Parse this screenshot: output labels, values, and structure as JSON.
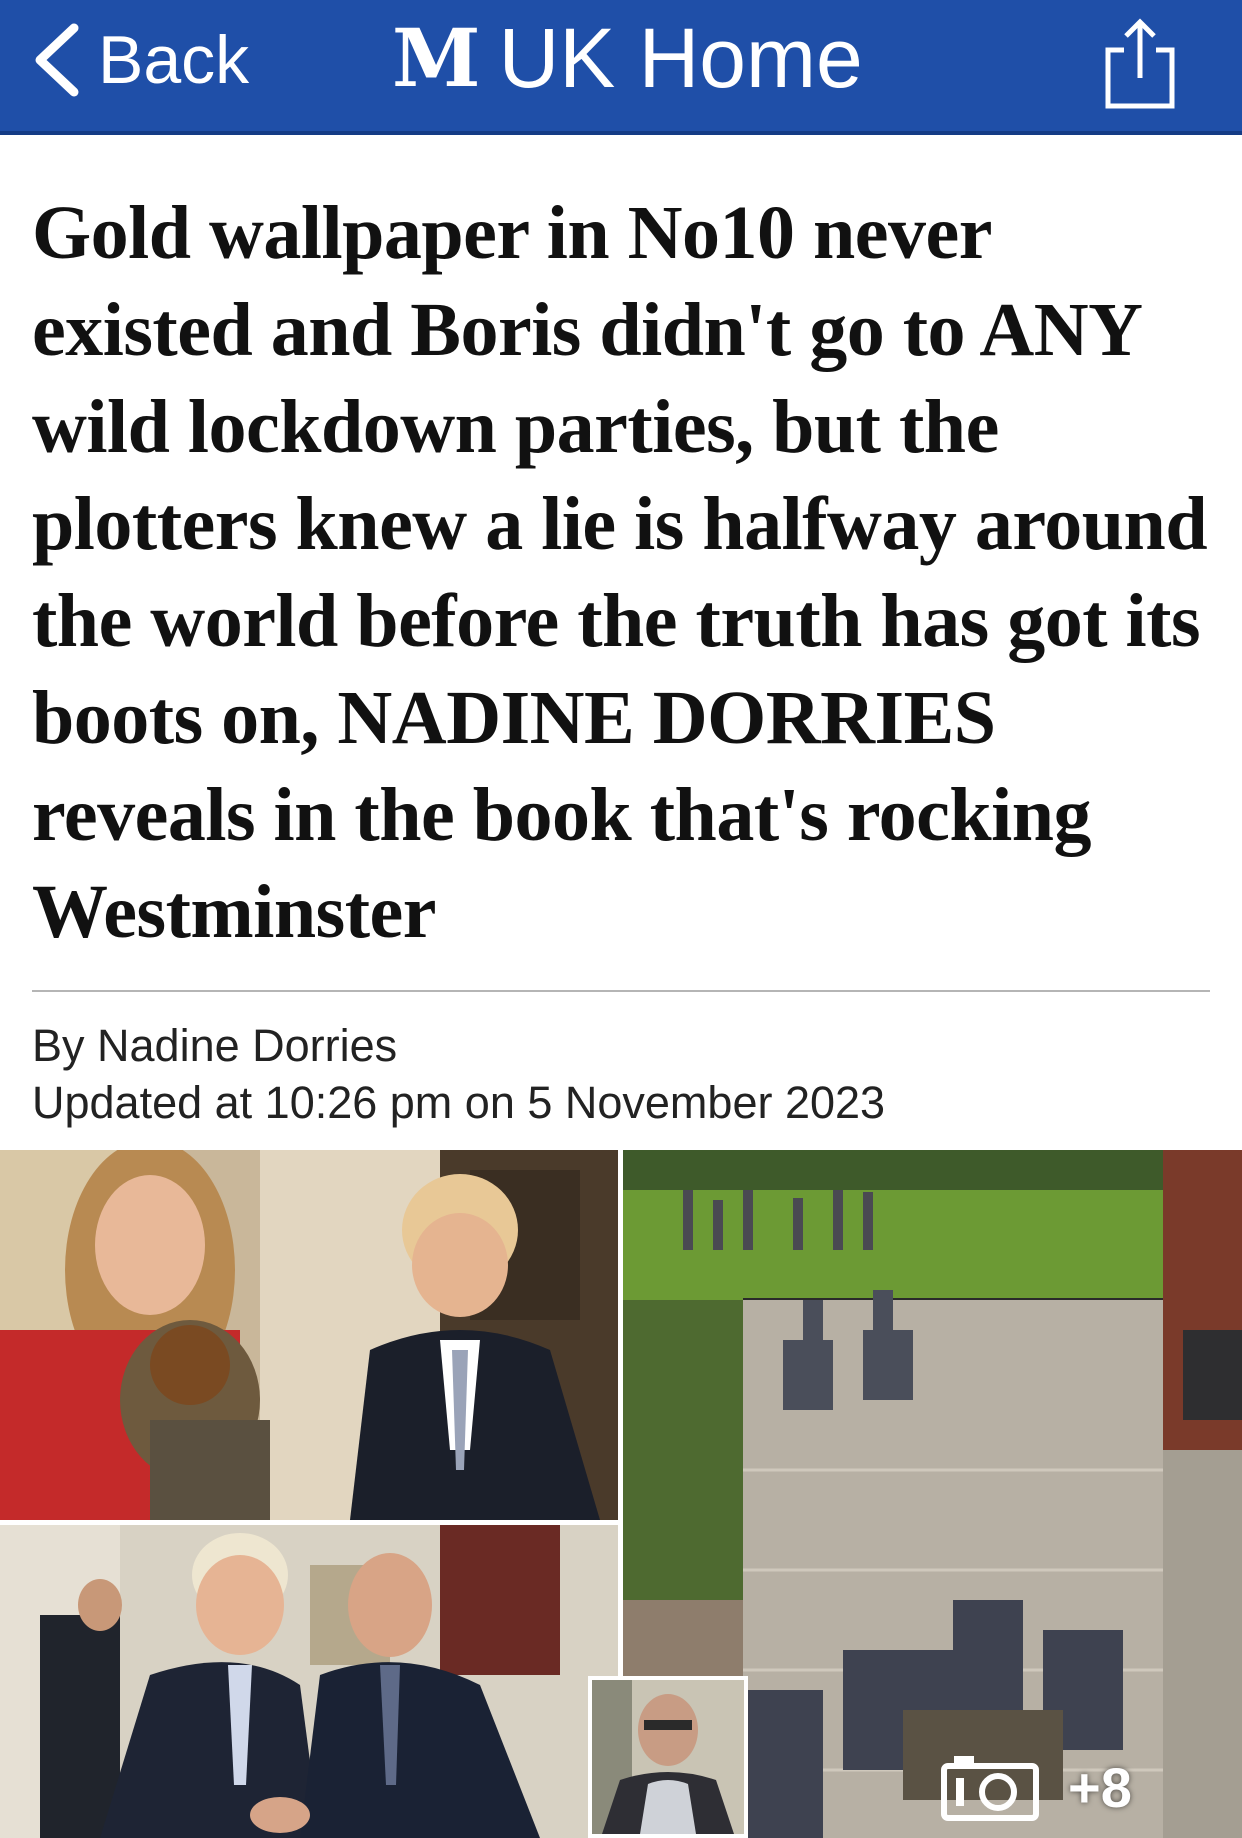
{
  "header": {
    "back_label": "Back",
    "logo_mark": "M",
    "section_title": "UK Home",
    "bar_color": "#1f4fa8"
  },
  "article": {
    "headline": "Gold wallpaper in No10 never existed and Boris didn't go to ANY wild lockdown parties, but the plotters knew a lie is halfway around the world before the truth has got its boots on, NADINE DORRIES reveals in the book that's rocking Westminster",
    "byline": "By Nadine Dorries",
    "updated": "Updated at 10:26 pm on 5 November 2023"
  },
  "gallery": {
    "count_label": "+8",
    "icons": {
      "camera": "camera-icon",
      "share": "share-icon",
      "back": "chevron-left-icon"
    }
  }
}
